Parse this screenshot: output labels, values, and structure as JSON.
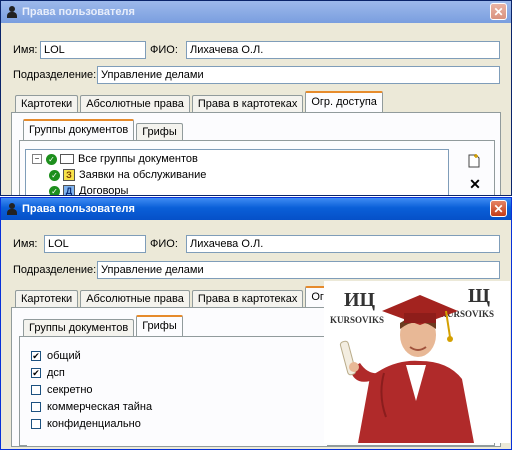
{
  "window_title": "Права пользователя",
  "close_glyph": "✕",
  "fields": {
    "name_label": "Имя:",
    "name_value": "LOL",
    "fio_label": "ФИО:",
    "fio_value": "Лихачева О.Л.",
    "dept_label": "Подразделение:",
    "dept_value": "Управление делами"
  },
  "main_tabs": [
    "Картотеки",
    "Абсолютные права",
    "Права в картотеках",
    "Огр. доступа"
  ],
  "sub_tabs": [
    "Группы документов",
    "Грифы"
  ],
  "back_window": {
    "tree": {
      "root": "Все группы документов",
      "children": [
        {
          "label": "Заявки на обслуживание",
          "icon_letter": "З"
        },
        {
          "label": "Договоры",
          "icon_letter": "Д"
        }
      ]
    },
    "add_icon": "add-document-icon",
    "delete_glyph": "✕"
  },
  "front_window": {
    "checkboxes": [
      {
        "label": "общий",
        "checked": true
      },
      {
        "label": "дсп",
        "checked": true
      },
      {
        "label": "секретно",
        "checked": false
      },
      {
        "label": "коммерческая тайна",
        "checked": false
      },
      {
        "label": "конфиденциально",
        "checked": false
      }
    ]
  },
  "watermark": {
    "logo_left": "ИЦ",
    "logo_right": "Щ",
    "brand_left": "KURSOVIKS",
    "brand_right": "KURSOVIKS"
  },
  "colors": {
    "title_active": "#0a5fd8",
    "window_bg": "#ECE9D8",
    "active_tab_accent": "#e68b2c",
    "gown": "#b02a2a"
  }
}
